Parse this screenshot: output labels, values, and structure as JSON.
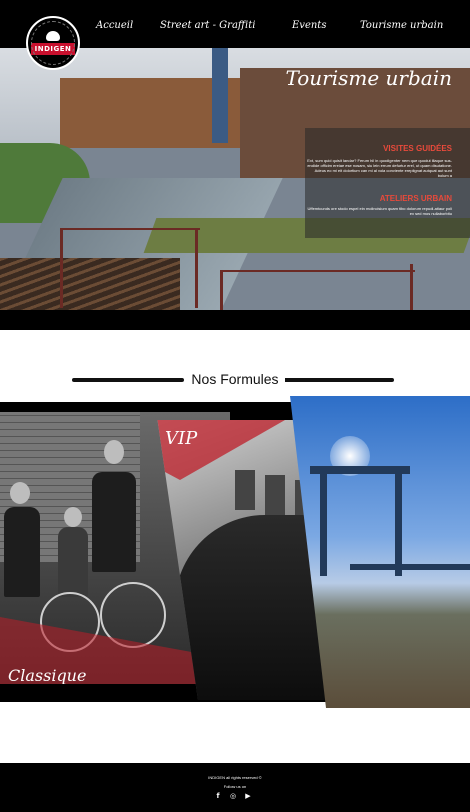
{
  "nav": {
    "logo_text": "INDIGEN",
    "items": [
      {
        "label": "Accueil"
      },
      {
        "label": "Street art - Graffiti"
      },
      {
        "label": "Events"
      },
      {
        "label": "Tourisme urbain"
      }
    ]
  },
  "hero": {
    "title": "Tourisme urbain",
    "visites": {
      "heading": "VISITES GUIDÉES",
      "text": "Ext, sum quid quisit landar? Ferum hil in quodigenter nem que quodut illaque sus-endide officim ereiae ese nosam, siu lein errum defurtur erel, ut quam disutatione. Adeus eo mi eit dolortium can mi al vola conviente ereplignat autquat aut sunt bolum a"
    },
    "ateliers": {
      "heading": "ATELIERS URBAIN",
      "text": "Uffemtcunds ore stodo espel ein molincisium quam tibo dolorum repudi-atiaur poli ex sed mos nullaborbitu"
    }
  },
  "formules": {
    "title": "Nos Formules",
    "cards": [
      {
        "label": "Classique"
      },
      {
        "label": "VIP"
      }
    ]
  },
  "footer": {
    "copyright": "INDIGEN all rights reserved ©",
    "follow": "Follow us on",
    "social_icons": [
      "facebook-icon",
      "instagram-icon",
      "youtube-icon"
    ]
  },
  "colors": {
    "accent_red": "#e84a3b",
    "black": "#000000"
  }
}
